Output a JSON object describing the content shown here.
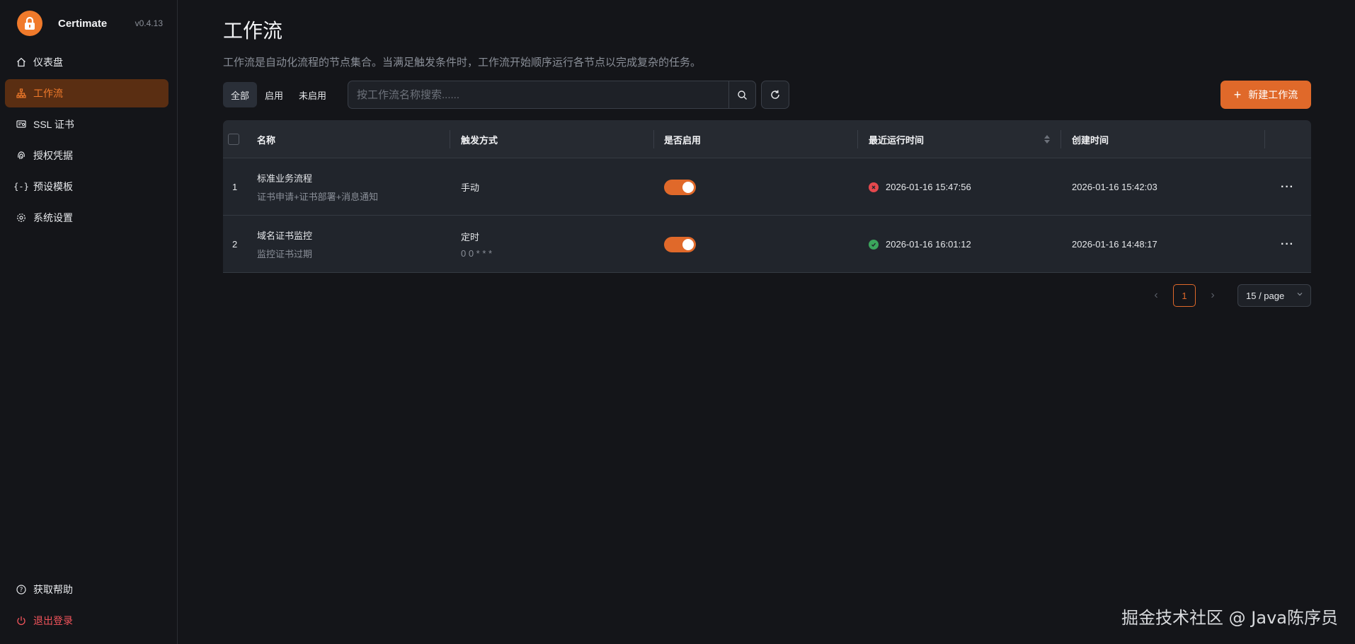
{
  "sidebar": {
    "brand": {
      "name": "Certimate",
      "version": "v0.4.13"
    },
    "items": [
      {
        "label": "仪表盘",
        "icon": "home-icon"
      },
      {
        "label": "工作流",
        "icon": "workflow-icon",
        "active": true
      },
      {
        "label": "SSL 证书",
        "icon": "certificate-icon"
      },
      {
        "label": "授权凭据",
        "icon": "fingerprint-icon"
      },
      {
        "label": "预设模板",
        "icon": "braces-icon"
      },
      {
        "label": "系统设置",
        "icon": "gear-icon"
      }
    ],
    "bottom": [
      {
        "label": "获取帮助",
        "icon": "help-icon"
      },
      {
        "label": "退出登录",
        "icon": "power-icon"
      }
    ]
  },
  "page": {
    "title": "工作流",
    "description": "工作流是自动化流程的节点集合。当满足触发条件时，工作流开始顺序运行各节点以完成复杂的任务。"
  },
  "toolbar": {
    "filters": [
      "全部",
      "启用",
      "未启用"
    ],
    "active_filter": "全部",
    "search_placeholder": "按工作流名称搜索......",
    "new_button": "新建工作流"
  },
  "table": {
    "columns": [
      "名称",
      "触发方式",
      "是否启用",
      "最近运行时间",
      "创建时间"
    ],
    "rows": [
      {
        "index": "1",
        "name": "标准业务流程",
        "desc": "证书申请+证书部署+消息通知",
        "trigger": "手动",
        "trigger_sub": "",
        "enabled": true,
        "last_run_status": "failed",
        "last_run": "2026-01-16 15:47:56",
        "created": "2026-01-16 15:42:03"
      },
      {
        "index": "2",
        "name": "域名证书监控",
        "desc": "监控证书过期",
        "trigger": "定时",
        "trigger_sub": "0 0 * * *",
        "enabled": true,
        "last_run_status": "succeeded",
        "last_run": "2026-01-16 16:01:12",
        "created": "2026-01-16 14:48:17"
      }
    ]
  },
  "pagination": {
    "current": "1",
    "page_size": "15 / page"
  },
  "watermark": "掘金技术社区 @ Java陈序员",
  "colors": {
    "accent": "#e0692a",
    "error": "#e5484d",
    "success": "#3ba55c",
    "background": "#141519"
  }
}
